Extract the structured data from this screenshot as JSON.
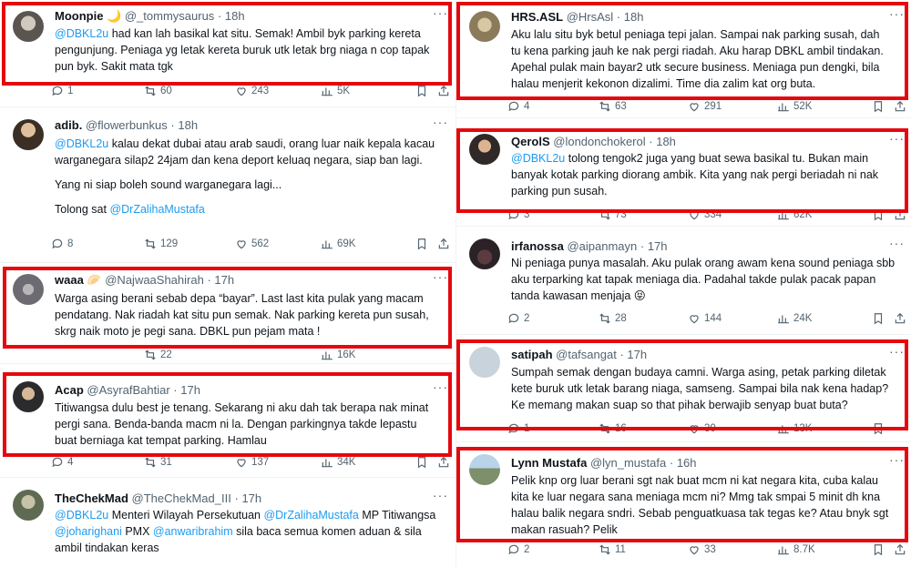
{
  "highlight_color": "#e5080d",
  "left_tweets": [
    {
      "name": "Moonpie 🌙",
      "handle": "@_tommysaurus",
      "time": "18h",
      "lines": [
        "@DBKL2u had kan lah basikal kat situ. Semak! Ambil byk parking kereta",
        "pengunjung. Peniaga yg  letak kereta buruk utk letak brg niaga n cop tapak",
        "pun byk. Sakit mata tgk"
      ],
      "replies": "1",
      "retweets": "60",
      "likes": "243",
      "views": "5K"
    },
    {
      "name": "adib.",
      "handle": "@flowerbunkus",
      "time": "18h",
      "lines": [
        "@DBKL2u kalau dekat dubai atau arab saudi, orang luar naik kepala kacau",
        "warganegara silap2 24jam dan kena deport keluaq negara, siap ban lagi.",
        "",
        "Yang ni siap boleh sound warganegara lagi...",
        "",
        "Tolong sat @DrZalihaMustafa"
      ],
      "replies": "8",
      "retweets": "129",
      "likes": "562",
      "views": "69K"
    },
    {
      "name": "waaa 🥟",
      "handle": "@NajwaaShahirah",
      "time": "17h",
      "lines": [
        "Warga asing berani sebab depa “bayar”. Last last kita pulak yang macam",
        "pendatang. Nak riadah kat situ pun semak. Nak parking kereta pun susah,",
        "skrg naik moto je pegi sana. DBKL pun pejam mata !"
      ],
      "replies": "",
      "retweets": "22",
      "likes": "",
      "views": "16K"
    },
    {
      "name": "Acap",
      "handle": "@AsyrafBahtiar",
      "time": "17h",
      "lines": [
        "Titiwangsa dulu best je tenang. Sekarang ni aku dah tak berapa nak minat",
        "pergi sana. Benda-banda macm ni la. Dengan parkingnya takde lepastu",
        "buat berniaga kat tempat parking. Hamlau"
      ],
      "replies": "4",
      "retweets": "31",
      "likes": "137",
      "views": "34K"
    },
    {
      "name": "TheChekMad",
      "handle": "@TheChekMad_III",
      "time": "17h",
      "lines": [
        "@DBKL2u Menteri Wilayah Persekutuan @DrZalihaMustafa MP Titiwangsa",
        "@joharighani  PMX @anwaribrahim sila baca semua komen aduan & sila",
        "ambil tindakan keras"
      ],
      "replies": "",
      "retweets": "",
      "likes": "",
      "views": ""
    }
  ],
  "right_tweets": [
    {
      "name": "HRS.ASL",
      "handle": "@HrsAsl",
      "time": "18h",
      "lines": [
        "Aku lalu situ byk betul peniaga tepi jalan. Sampai nak parking susah, dah",
        "tu kena parking jauh ke nak pergi riadah. Aku harap DBKL ambil tindakan.",
        "Apehal pulak main bayar2 utk secure business. Meniaga pun dengki, bila",
        "halau menjerit kekonon dizalimi. Time dia zalim kat org buta."
      ],
      "replies": "4",
      "retweets": "63",
      "likes": "291",
      "views": "52K"
    },
    {
      "name": "QerolS",
      "handle": "@londonchokerol",
      "time": "18h",
      "lines": [
        "@DBKL2u tolong tengok2 juga yang buat sewa basikal tu. Bukan main",
        "banyak kotak parking diorang ambik. Kita yang nak pergi beriadah ni nak",
        "parking pun susah."
      ],
      "replies": "3",
      "retweets": "73",
      "likes": "334",
      "views": "62K"
    },
    {
      "name": "irfanossa",
      "handle": "@aipanmayn",
      "time": "17h",
      "lines": [
        "Ni peniaga punya masalah. Aku pulak orang awam kena sound peniaga sbb",
        "aku terparking kat tapak meniaga dia. Padahal takde pulak pacak papan",
        "tanda kawasan menjaja 😝"
      ],
      "replies": "2",
      "retweets": "28",
      "likes": "144",
      "views": "24K"
    },
    {
      "name": "satipah",
      "handle": "@tafsangat",
      "time": "17h",
      "lines": [
        "Sumpah semak dengan budaya camni. Warga asing, petak parking diletak",
        "kete buruk utk letak barang niaga, samseng. Sampai bila nak kena hadap?",
        "Ke memang makan suap so that pihak berwajib senyap buat buta?"
      ],
      "replies": "1",
      "retweets": "16",
      "likes": "30",
      "views": "13K"
    },
    {
      "name": "Lynn Mustafa",
      "handle": "@lyn_mustafa",
      "time": "16h",
      "lines": [
        "Pelik knp org luar berani sgt nak buat mcm ni kat negara kita, cuba kalau",
        "kita ke luar negara sana meniaga mcm ni? Mmg tak smpai 5 minit dh kna",
        "halau balik negara sndri. Sebab penguatkuasa tak tegas ke? Atau bnyk sgt",
        "makan rasuah? Pelik"
      ],
      "replies": "2",
      "retweets": "11",
      "likes": "33",
      "views": "8.7K"
    }
  ]
}
